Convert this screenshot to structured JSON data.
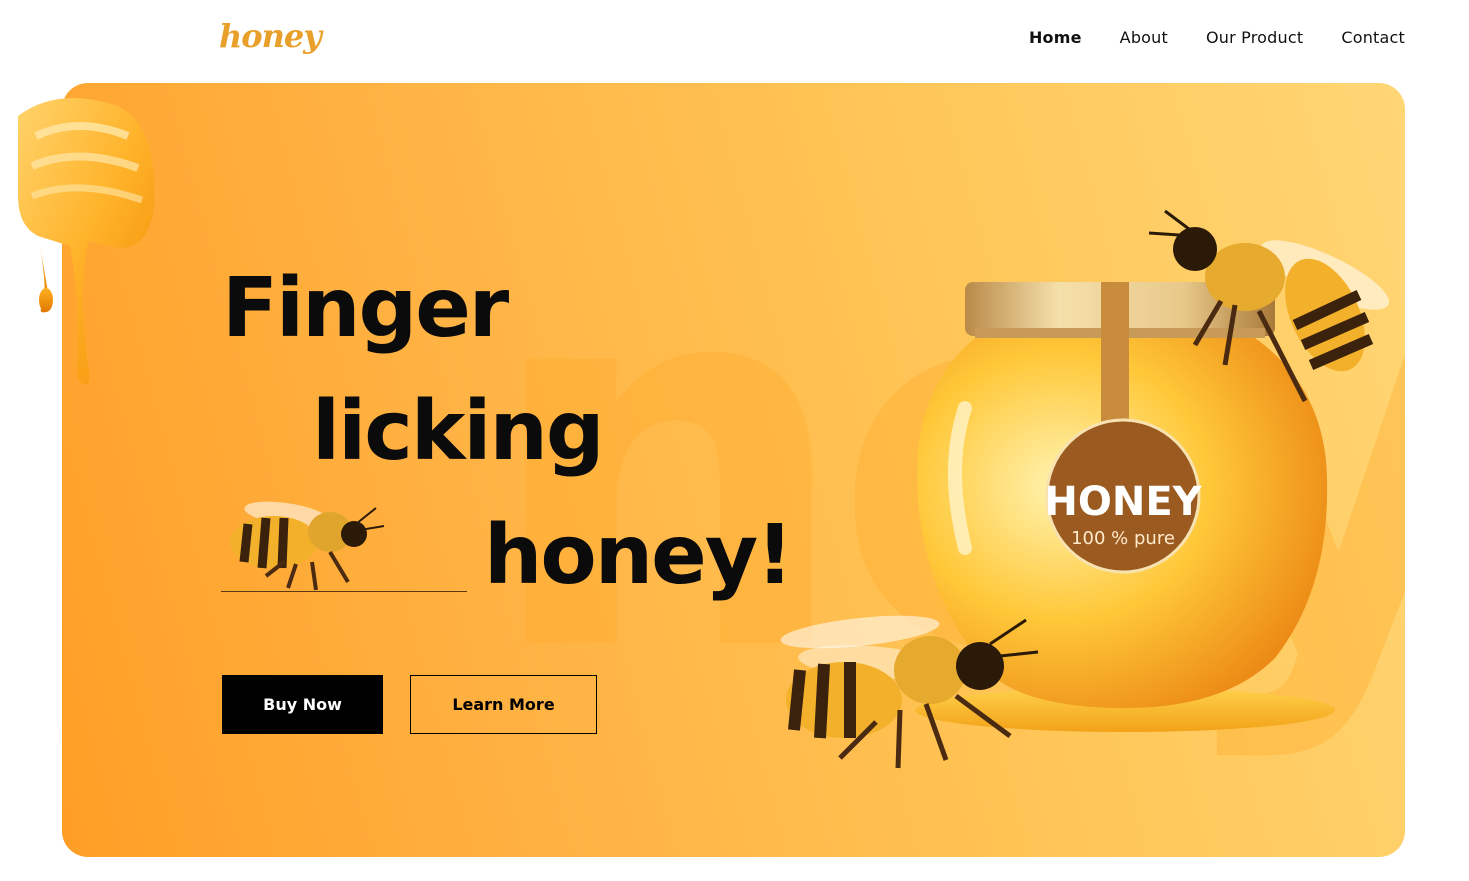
{
  "brand": {
    "logo_text": "honey",
    "accent": "#e9a02a"
  },
  "nav": {
    "items": [
      {
        "label": "Home",
        "active": true
      },
      {
        "label": "About",
        "active": false
      },
      {
        "label": "Our Product",
        "active": false
      },
      {
        "label": "Contact",
        "active": false
      }
    ]
  },
  "hero": {
    "watermark": "ney",
    "headline": [
      "Finger",
      "licking",
      "honey!"
    ],
    "buttons": {
      "buy": "Buy Now",
      "learn": "Learn More"
    },
    "jar_label": {
      "title": "HONEY",
      "subtitle": "100 % pure"
    },
    "colors": {
      "gradient_start": "#ff9e26",
      "gradient_end": "#ffd675",
      "button_dark": "#000000"
    }
  }
}
